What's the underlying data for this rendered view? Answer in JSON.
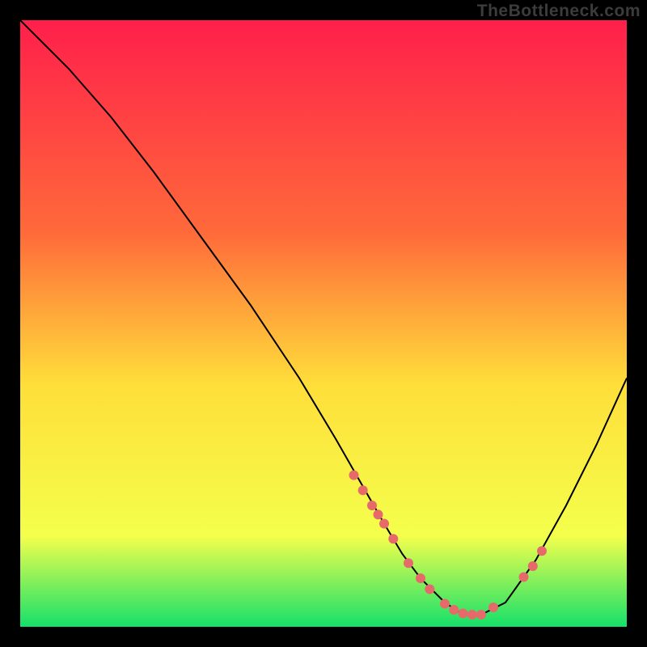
{
  "watermark": "TheBottleneck.com",
  "colors": {
    "gradient_top": "#ff1f4b",
    "gradient_mid_upper": "#ff6a3a",
    "gradient_mid": "#ffde3a",
    "gradient_lower": "#f4ff4c",
    "gradient_bottom": "#15e06a",
    "line": "#000000",
    "dot": "#e76a6a",
    "frame": "#000000"
  },
  "chart_data": {
    "type": "line",
    "title": "",
    "xlabel": "",
    "ylabel": "",
    "xlim": [
      0,
      100
    ],
    "ylim": [
      0,
      100
    ],
    "series": [
      {
        "name": "bottleneck-curve",
        "x": [
          0,
          3,
          8,
          15,
          22,
          30,
          38,
          46,
          52,
          56,
          60,
          63,
          66,
          70,
          73,
          76,
          80,
          85,
          90,
          95,
          100
        ],
        "y": [
          100,
          97,
          92,
          84,
          75,
          64,
          53,
          41,
          31,
          24,
          17,
          12,
          8,
          4,
          2,
          2,
          4,
          11,
          20,
          30,
          41
        ]
      }
    ],
    "dots": {
      "name": "highlight-dots",
      "x": [
        55,
        56.5,
        58,
        59,
        60,
        61.5,
        64,
        66,
        67.5,
        70,
        71.5,
        73,
        74.5,
        76,
        78,
        83,
        84.5,
        86
      ],
      "y": [
        25,
        22.5,
        20,
        18.5,
        17,
        14.5,
        10.5,
        8,
        6.2,
        3.8,
        2.8,
        2.2,
        2,
        2,
        3.2,
        8.2,
        10,
        12.5
      ]
    }
  }
}
